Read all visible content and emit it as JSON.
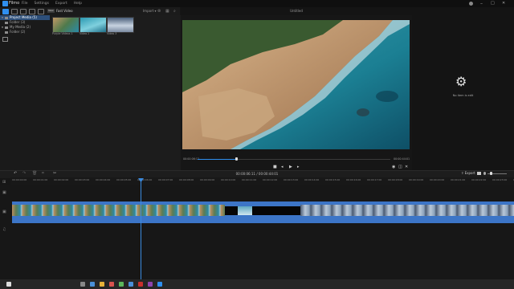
{
  "app": {
    "name": "Filmo",
    "menu": [
      "File",
      "Settings",
      "Export",
      "Help"
    ]
  },
  "window": {
    "minimize": "–",
    "maximize": "□",
    "close": "✕"
  },
  "toolbar": {
    "badge": "New",
    "label": "Fast Video",
    "import": "Import"
  },
  "sidebar": {
    "items": [
      {
        "label": "Project Media (5)"
      },
      {
        "label": "Folder (3)"
      },
      {
        "label": "My Media (2)"
      },
      {
        "label": "Folder (2)"
      }
    ]
  },
  "media": {
    "thumbs": [
      {
        "label": "Purple Videos 1"
      },
      {
        "label": "Video 2"
      },
      {
        "label": "Video 3"
      }
    ]
  },
  "viewer": {
    "title": "Untitled",
    "time_current": "00:00:06:12",
    "time_total": "00:00:44:01"
  },
  "playback": {
    "progress": 0.2
  },
  "properties": {
    "empty_text": "No item is edit",
    "icon": "gear-icon"
  },
  "timeline": {
    "time_display": "00:00:06:11 / 00:00:44:01",
    "export_label": "Export",
    "ruler_ticks": [
      "00:00:00:00",
      "00:00:01:00",
      "00:00:02:00",
      "00:00:03:00",
      "00:00:04:00",
      "00:00:05:00",
      "00:00:06:00",
      "00:00:07:00",
      "00:00:08:00",
      "00:00:09:00",
      "00:00:10:00",
      "00:00:11:00",
      "00:00:12:00",
      "00:00:13:00",
      "00:00:14:00",
      "00:00:15:00",
      "00:00:16:00",
      "00:00:17:00",
      "00:00:18:00",
      "00:00:19:00",
      "00:00:20:00",
      "00:00:21:00",
      "00:00:22:00",
      "00:00:23:00",
      "00:00:24:00"
    ]
  },
  "colors": {
    "accent": "#2f8ff0",
    "clip": "#3c75c7",
    "background": "#161616"
  }
}
